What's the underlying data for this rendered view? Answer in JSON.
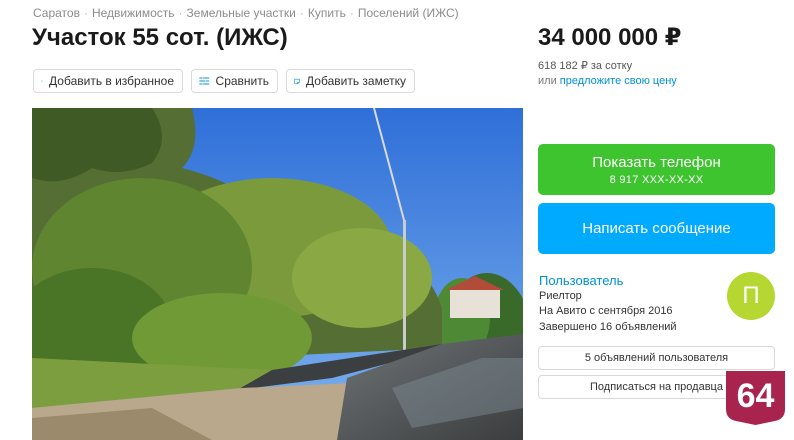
{
  "breadcrumb": [
    "Саратов",
    "Недвижимость",
    "Земельные участки",
    "Купить",
    "Поселений (ИЖС)"
  ],
  "breadcrumb_sep": "·",
  "title": "Участок 55 сот. (ИЖС)",
  "actions": {
    "favorite": "Добавить в избранное",
    "compare": "Сравнить",
    "note": "Добавить заметку"
  },
  "price": {
    "value": "34 000 000 ₽",
    "per_unit": "618 182 ₽ за сотку",
    "offer_prefix": "или ",
    "offer_link": "предложите свою цену"
  },
  "contact": {
    "phone_label": "Показать телефон",
    "phone_masked": "8 917 XXX-XX-XX",
    "message_label": "Написать сообщение"
  },
  "seller": {
    "name": "Пользователь",
    "type": "Риелтор",
    "since": "На Авито с сентября 2016",
    "completed": "Завершено 16 объявлений",
    "avatar_letter": "П",
    "avatar_color": "#b6d631"
  },
  "seller_buttons": {
    "listings": "5 объявлений пользователя",
    "subscribe": "Подписаться на продавца"
  },
  "badge": {
    "text": "64",
    "color": "#a8244f"
  },
  "colors": {
    "phone_button": "#3ec42f",
    "message_button": "#00aaff",
    "link": "#0091d9"
  },
  "icons": [
    "heart-icon",
    "compare-icon",
    "note-icon"
  ]
}
